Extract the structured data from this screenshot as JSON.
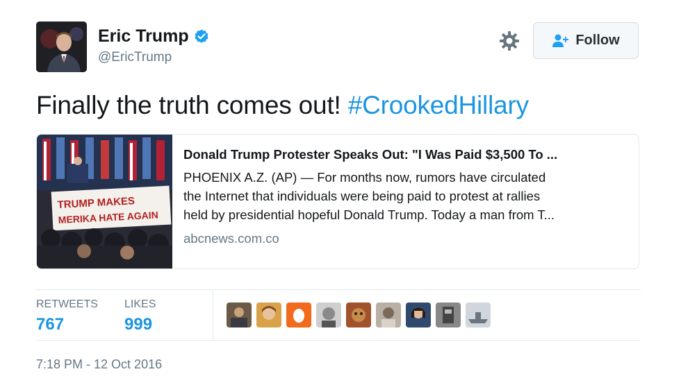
{
  "user": {
    "name": "Eric Trump",
    "handle": "@EricTrump",
    "verified": true
  },
  "actions": {
    "follow_label": "Follow",
    "settings_icon": "gear-icon",
    "follow_icon": "add-user-icon"
  },
  "tweet": {
    "text": "Finally the truth comes out! ",
    "hashtag": "#CrookedHillary"
  },
  "card": {
    "image_sign_line1": "TRUMP MAKES",
    "image_sign_line2": "MERIKA HATE AGAIN",
    "title": "Donald Trump Protester Speaks Out: \"I Was Paid $3,500 To ...",
    "description_lines": [
      "PHOENIX A.Z. (AP) — For months now, rumors have circulated",
      "the Internet that individuals were being paid to protest at rallies",
      "held by presidential hopeful Donald Trump. Today a man from T..."
    ],
    "domain": "abcnews.com.co"
  },
  "stats": {
    "retweets_label": "RETWEETS",
    "retweets_value": "767",
    "likes_label": "LIKES",
    "likes_value": "999",
    "likers_count_shown": 9
  },
  "timestamp": "7:18 PM - 12 Oct 2016",
  "colors": {
    "link": "#1b95e0",
    "secondary_text": "#657786",
    "border": "#e1e8ed",
    "verified": "#1da1f2"
  }
}
